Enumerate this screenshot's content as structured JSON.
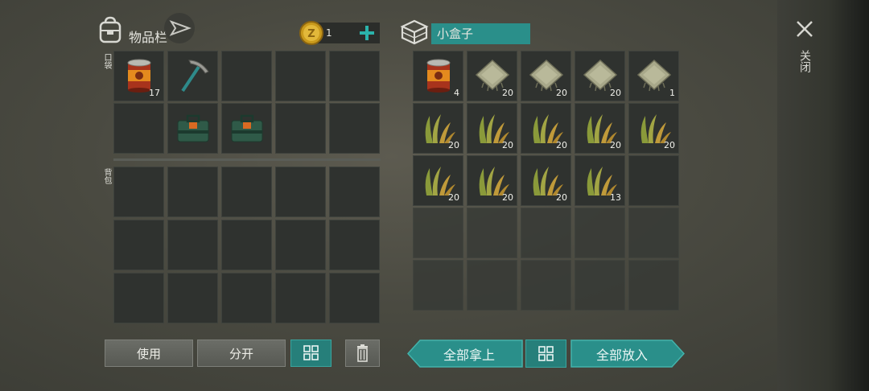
{
  "inventory": {
    "title": "物品栏",
    "pocket_label": "口袋",
    "backpack_label": "背包",
    "coin_count": "1",
    "pocket_slots": [
      {
        "item": "canned-food",
        "count": "17"
      },
      {
        "item": "pickaxe",
        "count": ""
      },
      {
        "item": "",
        "count": ""
      },
      {
        "item": "",
        "count": ""
      },
      {
        "item": "",
        "count": ""
      },
      {
        "item": "",
        "count": ""
      },
      {
        "item": "toolbox",
        "count": ""
      },
      {
        "item": "toolbox",
        "count": ""
      },
      {
        "item": "",
        "count": ""
      },
      {
        "item": "",
        "count": ""
      }
    ],
    "use_label": "使用",
    "split_label": "分开"
  },
  "container": {
    "name": "小盒子",
    "slots": [
      {
        "item": "canned-food",
        "count": "4"
      },
      {
        "item": "cloth",
        "count": "20"
      },
      {
        "item": "cloth",
        "count": "20"
      },
      {
        "item": "cloth",
        "count": "20"
      },
      {
        "item": "cloth",
        "count": "1"
      },
      {
        "item": "plant-fiber",
        "count": "20"
      },
      {
        "item": "plant-fiber",
        "count": "20"
      },
      {
        "item": "plant-fiber",
        "count": "20"
      },
      {
        "item": "plant-fiber",
        "count": "20"
      },
      {
        "item": "plant-fiber",
        "count": "20"
      },
      {
        "item": "plant-fiber",
        "count": "20"
      },
      {
        "item": "plant-fiber",
        "count": "20"
      },
      {
        "item": "plant-fiber",
        "count": "20"
      },
      {
        "item": "plant-fiber",
        "count": "13"
      },
      {
        "item": "",
        "count": ""
      }
    ],
    "take_all_label": "全部拿上",
    "put_all_label": "全部放入"
  },
  "close_label": "关闭",
  "colors": {
    "accent": "#2a8f8a",
    "slot": "#2f322f"
  }
}
